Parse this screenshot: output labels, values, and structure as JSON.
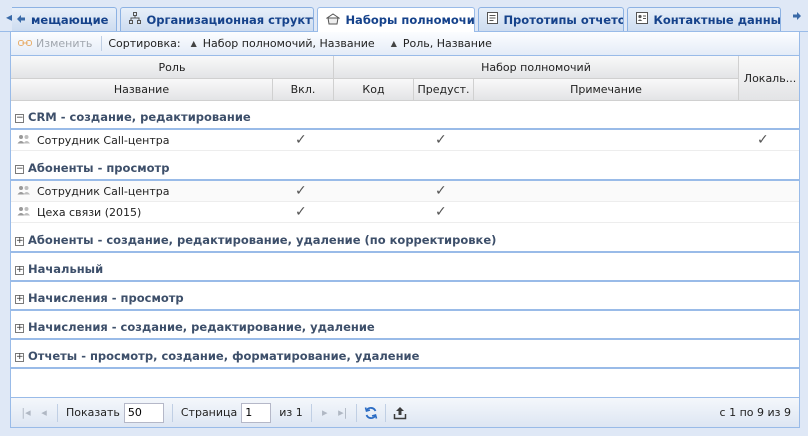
{
  "tabs": [
    {
      "label": "мещающие",
      "icon": "arrow-left-icon"
    },
    {
      "label": "Организационная структура",
      "icon": "org-structure-icon"
    },
    {
      "label": "Наборы полномочий",
      "icon": "permissions-icon",
      "active": true
    },
    {
      "label": "Прототипы отчетов",
      "icon": "report-icon"
    },
    {
      "label": "Контактные данные",
      "icon": "contacts-icon"
    }
  ],
  "toolbar": {
    "edit_label": "Изменить",
    "sort_label": "Сортировка:",
    "sort1": "Набор полномочий, Название",
    "sort2": "Роль, Название"
  },
  "headers": {
    "role": "Роль",
    "permset": "Набор полномочий",
    "local": "Локаль...",
    "name": "Название",
    "enabled": "Вкл.",
    "code": "Код",
    "predef": "Предуст.",
    "note": "Примечание"
  },
  "groups": [
    {
      "label": "CRM - создание, редактирование",
      "expanded": true,
      "rows": [
        {
          "name": "Сотрудник Call-центра",
          "enabled": true,
          "predef": true,
          "local": true
        }
      ]
    },
    {
      "label": "Абоненты - просмотр",
      "expanded": true,
      "rows": [
        {
          "name": "Сотрудник Call-центра",
          "enabled": true,
          "predef": true,
          "local": false
        },
        {
          "name": "Цеха связи (2015)",
          "enabled": true,
          "predef": true,
          "local": false
        }
      ]
    },
    {
      "label": "Абоненты - создание, редактирование, удаление (по корректировке)",
      "expanded": false,
      "rows": []
    },
    {
      "label": "Начальный",
      "expanded": false,
      "rows": []
    },
    {
      "label": "Начисления - просмотр",
      "expanded": false,
      "rows": []
    },
    {
      "label": "Начисления - создание, редактирование, удаление",
      "expanded": false,
      "rows": []
    },
    {
      "label": "Отчеты - просмотр, создание, форматирование, удаление",
      "expanded": false,
      "rows": []
    }
  ],
  "check_glyph": "✓",
  "toggle_expanded": "−",
  "toggle_collapsed": "+",
  "paging": {
    "show_label": "Показать",
    "page_size": "50",
    "page_label": "Страница",
    "page": "1",
    "of_label": "из 1",
    "info": "с 1 по 9 из 9"
  }
}
